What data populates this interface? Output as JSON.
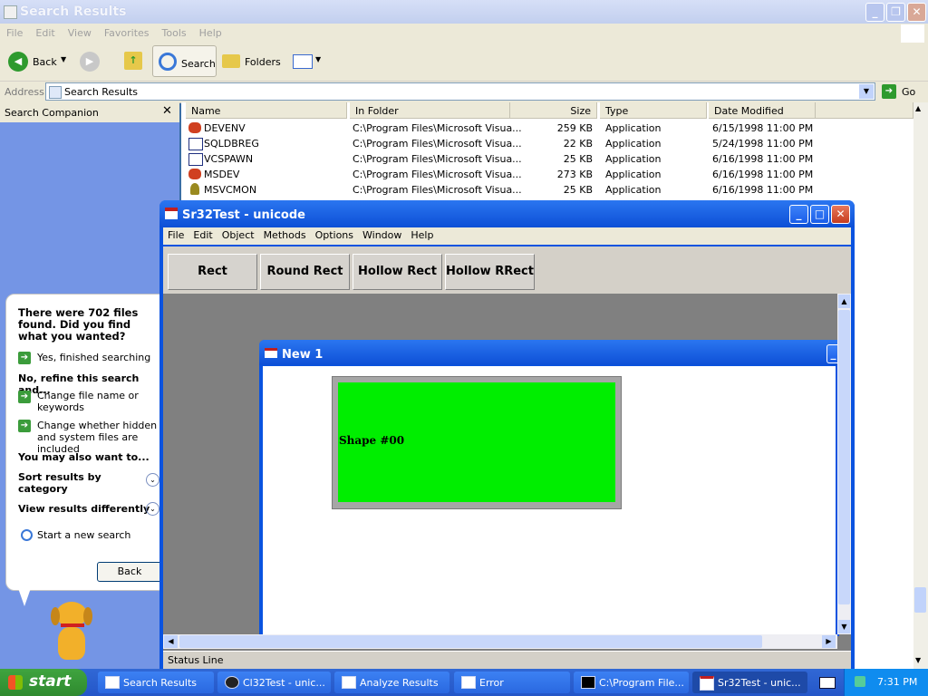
{
  "explorer": {
    "title": "Search Results",
    "menu": [
      "File",
      "Edit",
      "View",
      "Favorites",
      "Tools",
      "Help"
    ],
    "toolbar": {
      "back": "Back",
      "search": "Search",
      "folders": "Folders"
    },
    "address_label": "Address",
    "address_value": "Search Results",
    "go": "Go",
    "companion_title": "Search Companion",
    "columns": [
      "Name",
      "In Folder",
      "Size",
      "Type",
      "Date Modified"
    ],
    "rows": [
      {
        "name": "DEVENV",
        "folder": "C:\\Program Files\\Microsoft Visua...",
        "size": "259 KB",
        "type": "Application",
        "date": "6/15/1998 11:00 PM"
      },
      {
        "name": "SQLDBREG",
        "folder": "C:\\Program Files\\Microsoft Visua...",
        "size": "22 KB",
        "type": "Application",
        "date": "5/24/1998 11:00 PM"
      },
      {
        "name": "VCSPAWN",
        "folder": "C:\\Program Files\\Microsoft Visua...",
        "size": "25 KB",
        "type": "Application",
        "date": "6/16/1998 11:00 PM"
      },
      {
        "name": "MSDEV",
        "folder": "C:\\Program Files\\Microsoft Visua...",
        "size": "273 KB",
        "type": "Application",
        "date": "6/16/1998 11:00 PM"
      },
      {
        "name": "MSVCMON",
        "folder": "C:\\Program Files\\Microsoft Visua...",
        "size": "25 KB",
        "type": "Application",
        "date": "6/16/1998 11:00 PM"
      }
    ]
  },
  "companion": {
    "found": "There were 702 files found. Did you find what you wanted?",
    "yes": "Yes, finished searching",
    "refine": "No, refine this search and...",
    "change_name": "Change file name or keywords",
    "change_hidden": "Change whether hidden and system files are included",
    "also": "You may also want to...",
    "sort": "Sort results by category",
    "view": "View results differently",
    "new_search": "Start a new search",
    "back": "Back"
  },
  "app": {
    "title": "Sr32Test - unicode",
    "menu": [
      "File",
      "Edit",
      "Object",
      "Methods",
      "Options",
      "Window",
      "Help"
    ],
    "buttons": [
      "Rect",
      "Round Rect",
      "Hollow Rect",
      "Hollow RRect"
    ],
    "child_title": "New 1",
    "shape_label": "Shape #00",
    "status": "Status Line"
  },
  "taskbar": {
    "start": "start",
    "items": [
      "Search Results",
      "Cl32Test - unic...",
      "Analyze Results",
      "Error",
      "C:\\Program File...",
      "Sr32Test - unic..."
    ],
    "clock": "7:31 PM"
  },
  "colors": {
    "shape_fill": "#00ee00",
    "xp_blue": "#0a53e0",
    "start_green": "#3fa43f"
  }
}
